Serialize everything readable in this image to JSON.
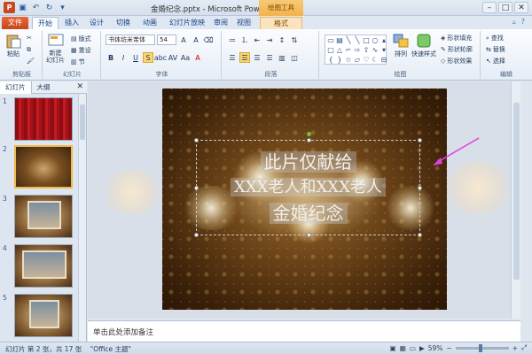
{
  "window": {
    "title": "金婚纪念.pptx - Microsoft PowerPoint",
    "context_tool": "绘图工具"
  },
  "tabs": [
    {
      "label": "文件",
      "kind": "file"
    },
    {
      "label": "开始",
      "kind": "active"
    },
    {
      "label": "插入"
    },
    {
      "label": "设计"
    },
    {
      "label": "切换"
    },
    {
      "label": "动画"
    },
    {
      "label": "幻灯片放映"
    },
    {
      "label": "审阅"
    },
    {
      "label": "视图"
    },
    {
      "label": "格式",
      "kind": "fmt"
    }
  ],
  "ribbon": {
    "clipboard": {
      "label": "剪贴板",
      "paste": "粘贴"
    },
    "slides": {
      "label": "幻灯片",
      "new_slide": "新建\n幻灯片",
      "layout": "版式",
      "reset": "重设",
      "section": "节"
    },
    "font": {
      "label": "字体",
      "family": "书体坊米芾体",
      "size": "54"
    },
    "paragraph": {
      "label": "段落"
    },
    "drawing": {
      "label": "绘图",
      "arrange": "排列",
      "quick_styles": "快速样式",
      "fill": "形状填充",
      "outline": "形状轮廓",
      "effects": "形状效果"
    },
    "editing": {
      "label": "编辑",
      "find": "查找",
      "replace": "替换",
      "select": "选择"
    }
  },
  "panel": {
    "tabs": [
      "幻灯片",
      "大纲"
    ],
    "thumbnails": [
      {
        "num": "1",
        "style": "red"
      },
      {
        "num": "2",
        "style": "brown",
        "selected": true
      },
      {
        "num": "3",
        "style": "photo"
      },
      {
        "num": "4",
        "style": "photo"
      },
      {
        "num": "5",
        "style": "photo"
      }
    ]
  },
  "slide": {
    "lines": [
      "此片仅献给",
      "XXX老人和XXX老人",
      "金婚纪念"
    ]
  },
  "notes": {
    "placeholder": "单击此处添加备注"
  },
  "status": {
    "slide_info": "幻灯片 第 2 张，共 17 张",
    "theme": "\"Office 主题\"",
    "zoom": "59%"
  },
  "colors": {
    "accent_arrow": "#e040e0",
    "file_tab": "#c7471c"
  }
}
